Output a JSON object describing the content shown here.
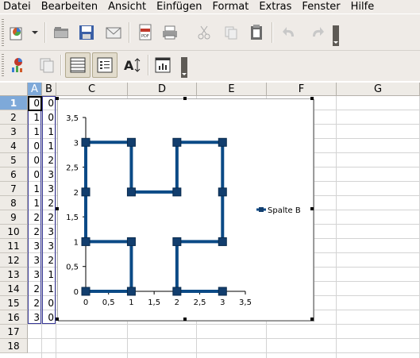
{
  "menubar": {
    "items": [
      {
        "label": "Datei",
        "name": "menu-datei"
      },
      {
        "label": "Bearbeiten",
        "name": "menu-bearbeiten"
      },
      {
        "label": "Ansicht",
        "name": "menu-ansicht"
      },
      {
        "label": "Einfügen",
        "name": "menu-einfuegen"
      },
      {
        "label": "Format",
        "name": "menu-format"
      },
      {
        "label": "Extras",
        "name": "menu-extras"
      },
      {
        "label": "Fenster",
        "name": "menu-fenster"
      },
      {
        "label": "Hilfe",
        "name": "menu-hilfe"
      }
    ]
  },
  "toolbar_standard": {
    "buttons": [
      "new-document-icon",
      "open-folder-icon",
      "save-icon",
      "email-icon",
      "export-pdf-icon",
      "print-icon",
      "cut-icon",
      "copy-icon",
      "paste-icon",
      "undo-icon",
      "redo-icon"
    ]
  },
  "toolbar_chart": {
    "buttons": [
      "chart-type-icon",
      "chart-data-table-icon",
      "horizontal-grid-icon",
      "legend-icon",
      "scale-text-icon",
      "chart-autoformat-icon"
    ]
  },
  "sheet": {
    "columns": [
      "A",
      "B",
      "C",
      "D",
      "E",
      "F",
      "G"
    ],
    "selected_column": "A",
    "rows": [
      "1",
      "2",
      "3",
      "4",
      "5",
      "6",
      "7",
      "8",
      "9",
      "10",
      "11",
      "12",
      "13",
      "14",
      "15",
      "16",
      "17",
      "18"
    ],
    "selected_row": "1",
    "col_a": [
      0,
      1,
      1,
      0,
      0,
      0,
      1,
      1,
      2,
      2,
      3,
      3,
      3,
      2,
      2,
      3
    ],
    "col_b": [
      0,
      0,
      1,
      1,
      2,
      3,
      3,
      2,
      2,
      3,
      3,
      2,
      1,
      1,
      0,
      0
    ]
  },
  "chart_data": {
    "type": "scatter",
    "x": [
      0,
      1,
      1,
      0,
      0,
      0,
      1,
      1,
      2,
      2,
      3,
      3,
      3,
      2,
      2,
      3
    ],
    "series": [
      {
        "name": "Spalte B",
        "values": [
          0,
          0,
          1,
          1,
          2,
          3,
          3,
          2,
          2,
          3,
          3,
          2,
          1,
          1,
          0,
          0
        ],
        "color": "#0b4a86"
      }
    ],
    "xlim": [
      0,
      3.5
    ],
    "ylim": [
      0,
      3.5
    ],
    "x_ticks": [
      "0",
      "0,5",
      "1",
      "1,5",
      "2",
      "2,5",
      "3",
      "3,5"
    ],
    "y_ticks": [
      "0",
      "0,5",
      "1",
      "1,5",
      "2",
      "2,5",
      "3",
      "3,5"
    ],
    "grid": false,
    "legend_position": "right",
    "title": "",
    "xlabel": "",
    "ylabel": ""
  }
}
